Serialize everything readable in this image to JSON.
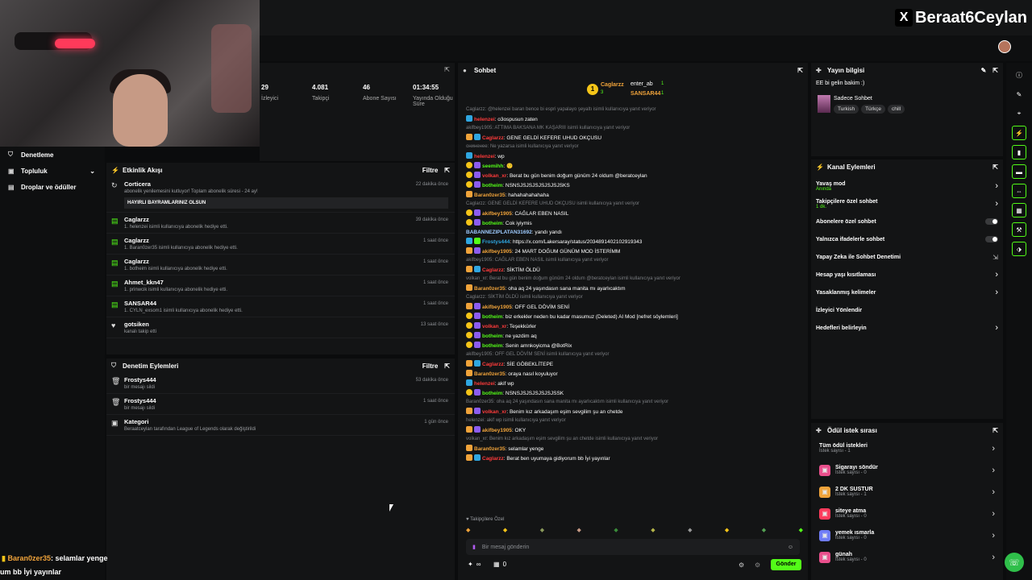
{
  "brand": {
    "handle": "Beraat6Ceylan",
    "x_label": "X"
  },
  "nav": {
    "items": [
      {
        "label": "Denetleme",
        "icon": "shield-icon"
      },
      {
        "label": "Topluluk",
        "icon": "users-icon",
        "chevron": "⌄"
      },
      {
        "label": "Droplar ve ödüller",
        "icon": "gift-icon"
      }
    ]
  },
  "stats": [
    {
      "value": "29",
      "label": "İzleyici"
    },
    {
      "value": "4.081",
      "label": "Takipçi"
    },
    {
      "value": "46",
      "label": "Abone Sayısı"
    },
    {
      "value": "01:34:55",
      "label": "Yayında Olduğu Süre"
    }
  ],
  "activity": {
    "title": "Etkinlik Akışı",
    "filter": "Filtre",
    "items": [
      {
        "name": "Corticera",
        "desc": "abonelik yenilemesini kutluyor! Toplam abonelik süresi - 24 ay!",
        "time": "22 dakika önce",
        "msg": "HAYIRLI BAYRAMLARINIZ OLSUN",
        "icon": "refresh-icon"
      },
      {
        "name": "Caglarzz",
        "desc": "1. helenzei isimli kullanıcıya abonelik hediye etti.",
        "time": "39 dakika önce",
        "icon": "gift-icon"
      },
      {
        "name": "Caglarzz",
        "desc": "1. Baran0zer35 isimli kullanıcıya abonelik hediye etti.",
        "time": "1 saat önce",
        "icon": "gift-icon"
      },
      {
        "name": "Caglarzz",
        "desc": "1. botheim isimli kullanıcıya abonelik hediye etti.",
        "time": "1 saat önce",
        "icon": "gift-icon"
      },
      {
        "name": "Ahmet_kkn47",
        "desc": "1. prinwcik isimli kullanıcıya abonelik hediye etti.",
        "time": "1 saat önce",
        "icon": "gift-icon"
      },
      {
        "name": "SANSAR44",
        "desc": "1. CYLN_exsom1 isimli kullanıcıya abonelik hediye etti.",
        "time": "1 saat önce",
        "icon": "gift-icon"
      },
      {
        "name": "gotsiken",
        "desc": "kanalı takip etti",
        "time": "13 saat önce",
        "icon": "heart-icon"
      }
    ]
  },
  "moderation": {
    "title": "Denetim Eylemleri",
    "filter": "Filtre",
    "items": [
      {
        "name": "Frostys444",
        "desc": "bir mesajı sildi",
        "time": "53 dakika önce",
        "icon": "trash-icon"
      },
      {
        "name": "Frostys444",
        "desc": "bir mesajı sildi",
        "time": "1 saat önce",
        "icon": "trash-icon"
      },
      {
        "name": "Kategori",
        "desc": "Beraatceylan tarafından League of Legends olarak değiştirildi",
        "time": "1 gün önce",
        "icon": "category-icon"
      }
    ]
  },
  "chat": {
    "title": "Sohbet",
    "leaders": [
      {
        "name": "Caglarzz",
        "count": "3"
      },
      {
        "name": "enter_ab",
        "count": "1"
      },
      {
        "name": "SANSAR44",
        "count": "1"
      }
    ],
    "messages": [
      {
        "reply": "Caglarzz: @helenzei baran bence bi espri yapalayo şeyaltı isimli kullanıcıya yanıt veriyor"
      },
      {
        "user": "helenzei",
        "color": "#ff3b3b",
        "badges": [
          "b3"
        ],
        "text": ": o3ospusun zaten"
      },
      {
        "reply": "akifbey1905: ATTIMA BAKSANA MK KAŞARIII isimli kullanıcıya yanıt veriyor"
      },
      {
        "user": "Caglarzz",
        "color": "#ff3b3b",
        "badges": [
          "b4",
          "b3"
        ],
        "text": ": GENE GELDİ KEFERE UHUD OKÇUSU"
      },
      {
        "reply": "ониненее: Ne yazarsa isimli kullanıcıya yanıt veriyor"
      },
      {
        "user": "helenzei",
        "color": "#ff3b3b",
        "badges": [
          "b3"
        ],
        "text": ": wp"
      },
      {
        "user": "seemihh",
        "color": "#53fc18",
        "badges": [
          "b1",
          "b2"
        ],
        "text": ": 🙂"
      },
      {
        "user": "volkan_xr",
        "color": "#ff3b3b",
        "badges": [
          "b1",
          "b2"
        ],
        "text": ": Berat bu gün benim doğum günüm 24 oldum @beratceylan"
      },
      {
        "user": "botheim",
        "color": "#53fc18",
        "badges": [
          "b1",
          "b2"
        ],
        "text": ": NSNSJSJSJSJSJSJSJSKS"
      },
      {
        "user": "Baran0zer35",
        "color": "#f0a33a",
        "badges": [
          "b4"
        ],
        "text": ": hahahahahahaha"
      },
      {
        "reply": "Caglarzz: GENE GELDİ KEFERE UHUD OKÇUSU isimli kullanıcıya yanıt veriyor"
      },
      {
        "user": "akifbey1905",
        "color": "#f0a33a",
        "badges": [
          "b1",
          "b2"
        ],
        "text": ": CAĞLAR EBEN NASIL"
      },
      {
        "user": "botheim",
        "color": "#53fc18",
        "badges": [
          "b1",
          "b2"
        ],
        "text": ": Cok iyiymis"
      },
      {
        "user": "BABANNEZIPLATAN31692",
        "color": "#9ecbff",
        "badges": [],
        "text": ": yandı yandı"
      },
      {
        "user": "Frostys444",
        "color": "#2fa6e0",
        "badges": [
          "b3",
          "b5"
        ],
        "text": ": https://x.com/Lakersaray/status/2034891402102919343"
      },
      {
        "user": "akifbey1905",
        "color": "#f0a33a",
        "badges": [
          "b4",
          "b2"
        ],
        "text": ": 24 MART DOĞUM GÜNÜM MOD İSTERİMM"
      },
      {
        "reply": "akifbey1905: CAĞLAR EBEN NASIL isimli kullanıcıya yanıt veriyor"
      },
      {
        "user": "Caglarzz",
        "color": "#ff3b3b",
        "badges": [
          "b4",
          "b3"
        ],
        "text": ": SİKTİM ÖLDÜ"
      },
      {
        "reply": "volkan_xr: Berat bu gün benim doğum günüm 24 oldum @beratceylan isimli kullanıcıya yanıt veriyor"
      },
      {
        "user": "Baran0zer35",
        "color": "#f0a33a",
        "badges": [
          "b4"
        ],
        "text": ": oha aq 24 yaşındasın sana manita mı ayarlıcaktım"
      },
      {
        "reply": "Caglarzz: SİKTİM ÖLDÜ isimli kullanıcıya yanıt veriyor"
      },
      {
        "user": "akifbey1905",
        "color": "#f0a33a",
        "badges": [
          "b4",
          "b2"
        ],
        "text": ": OFF GEL DÖVİM SENİ"
      },
      {
        "user": "botheim",
        "color": "#53fc18",
        "badges": [
          "b1",
          "b2"
        ],
        "text": ": biz erkekler neden bu kadar masumuz (Deleted) AI Mod [nefret söylemleri]"
      },
      {
        "user": "volkan_xr",
        "color": "#ff3b3b",
        "badges": [
          "b1",
          "b2"
        ],
        "text": ": Teşekkürler"
      },
      {
        "user": "botheim",
        "color": "#53fc18",
        "badges": [
          "b1",
          "b2"
        ],
        "text": ": ne yazdim aq"
      },
      {
        "user": "botheim",
        "color": "#53fc18",
        "badges": [
          "b1",
          "b2"
        ],
        "text": ": Senin amnkoyicma @BotRix"
      },
      {
        "reply": "akifbey1905: OFF GEL DÖVİM SENİ isimli kullanıcıya yanıt veriyor"
      },
      {
        "user": "Caglarzz",
        "color": "#ff3b3b",
        "badges": [
          "b4",
          "b3"
        ],
        "text": ": SİE GÖBEKLİTEPE"
      },
      {
        "user": "Baran0zer35",
        "color": "#f0a33a",
        "badges": [
          "b4"
        ],
        "text": ": oraya nasıl koyuluyor"
      },
      {
        "user": "helenzei",
        "color": "#ff3b3b",
        "badges": [
          "b3"
        ],
        "text": ": akif wp"
      },
      {
        "user": "botheim",
        "color": "#53fc18",
        "badges": [
          "b1",
          "b2"
        ],
        "text": ": NSNSJSJSJSJSJSJSSK"
      },
      {
        "reply": "Baran0zer35: oha aq 24 yaşındasın sana manita mı ayarlıcaktım isimli kullanıcıya yanıt veriyor"
      },
      {
        "user": "volkan_xr",
        "color": "#ff3b3b",
        "badges": [
          "b4",
          "b2"
        ],
        "text": ": Benim kız arkadaşım eşim sevgilim şu an chetde"
      },
      {
        "reply": "helenzei: akif wp isimli kullanıcıya yanıt veriyor"
      },
      {
        "user": "akifbey1905",
        "color": "#f0a33a",
        "badges": [
          "b4",
          "b2"
        ],
        "text": ": OKY"
      },
      {
        "reply": "volkan_xr: Benim kız arkadaşım eşim sevgilim şu an chetde isimli kullanıcıya yanıt veriyor"
      },
      {
        "user": "Baran0zer35",
        "color": "#f0a33a",
        "badges": [
          "b4"
        ],
        "text": ": selamlar yenge"
      },
      {
        "user": "Caglarzz",
        "color": "#ff3b3b",
        "badges": [
          "b4",
          "b3"
        ],
        "text": ": Berat ben uyumaya gidiyorum bb İyi yayınlar"
      }
    ],
    "followers_only": "Takipçilere Özel",
    "input_placeholder": "Bir mesaj gönderin",
    "points": "∞",
    "count": "0",
    "send_label": "Gönder"
  },
  "stream_info": {
    "title": "Yayın bilgisi",
    "stream_title": "EE bi gelin bakim :)",
    "category": "Sadece Sohbet",
    "tags": [
      "Turkish",
      "Türkçe",
      "chill"
    ]
  },
  "channel_actions": {
    "title": "Kanal Eylemleri",
    "items": [
      {
        "label": "Yavaş mod",
        "sub": "Anında",
        "kind": "chevron"
      },
      {
        "label": "Takipçilere özel sohbet",
        "sub": "1 dk.",
        "kind": "chevron"
      },
      {
        "label": "Abonelere özel sohbet",
        "kind": "toggle"
      },
      {
        "label": "Yalnızca ifadelerle sohbet",
        "kind": "toggle"
      },
      {
        "label": "Yapay Zeka ile Sohbet Denetimi",
        "kind": "external"
      },
      {
        "label": "Hesap yaşı kısıtlaması",
        "kind": "chevron"
      },
      {
        "label": "Yasaklanmış kelimeler",
        "kind": "chevron"
      },
      {
        "label": "İzleyici Yönlendir",
        "kind": "none"
      },
      {
        "label": "Hedefleri belirleyin",
        "kind": "chevron"
      }
    ]
  },
  "rewards": {
    "title": "Ödül istek sırası",
    "all_label": "Tüm ödül istekleri",
    "all_count": "İstek sayısı - 1",
    "items": [
      {
        "name": "Sigarayı söndür",
        "count": "İstek sayısı - 0",
        "color": "#e94f8c"
      },
      {
        "name": "2 DK SUSTUR",
        "count": "İstek sayısı - 1",
        "color": "#f0a33a"
      },
      {
        "name": "siteye atma",
        "count": "İstek sayısı - 0",
        "color": "#ff3b5c"
      },
      {
        "name": "yemek ısmarla",
        "count": "İstek sayısı - 0",
        "color": "#6f7cf7"
      },
      {
        "name": "günah",
        "count": "İstek sayısı - 0",
        "color": "#e94f8c"
      }
    ]
  },
  "overlay": {
    "user": "Baran0zer35",
    "msg": ": selamlar yenge",
    "line2": "um bb İyi yayınlar"
  }
}
